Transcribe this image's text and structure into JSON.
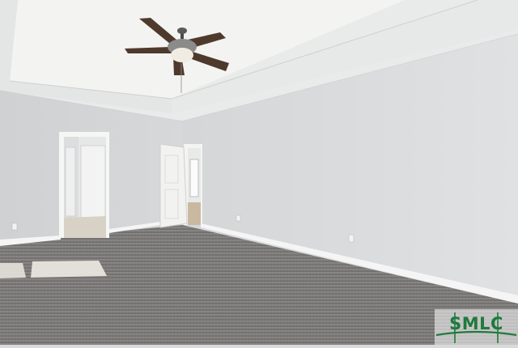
{
  "scene": {
    "description_colors": {
      "ceiling": "#f1f1f0",
      "wall_left": "#d3d5d6",
      "wall_right": "#dcddde",
      "carpet": "#7e7c7b",
      "trim": "#f4f4f4",
      "fan_blade": "#4e3a2c"
    }
  },
  "watermark": {
    "text": "SMLC",
    "color": "#1f7a3d"
  }
}
